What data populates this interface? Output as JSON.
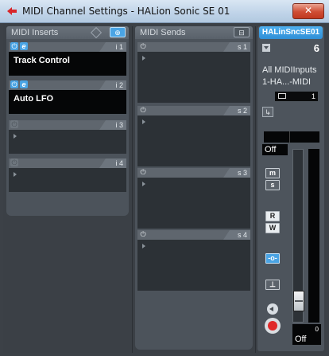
{
  "window": {
    "title": "MIDI Channel Settings - HALion Sonic SE 01",
    "close_label": "✕"
  },
  "midi_inserts": {
    "label": "MIDI Inserts",
    "slots": [
      {
        "number": "i 1",
        "plugin": "Track Control",
        "active": true
      },
      {
        "number": "i 2",
        "plugin": "Auto LFO",
        "active": true
      },
      {
        "number": "i 3",
        "plugin": "",
        "active": false
      },
      {
        "number": "i 4",
        "plugin": "",
        "active": false
      }
    ]
  },
  "midi_sends": {
    "label": "MIDI Sends",
    "slots": [
      {
        "number": "s 1"
      },
      {
        "number": "s 2"
      },
      {
        "number": "s 3"
      },
      {
        "number": "s 4"
      }
    ]
  },
  "channel": {
    "name": "HALinSncSE01",
    "number": "6",
    "input": "All MIDIInputs",
    "output": "1-HA...-MIDI",
    "midi_channel": "1",
    "meter_value": "Off",
    "output_value": "0",
    "output_text": "Off",
    "mute": "m",
    "solo": "s",
    "read": "R",
    "write": "W"
  },
  "colors": {
    "accent": "#4aa4e4",
    "record": "#e02a2a"
  }
}
